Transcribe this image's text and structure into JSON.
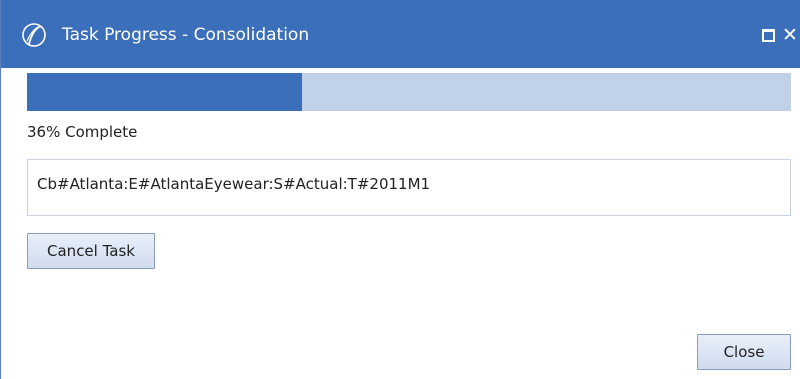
{
  "window": {
    "title": "Task Progress - Consolidation",
    "title_bar_color": "#3c6fb9",
    "maximize_icon": "maximize-icon",
    "close_icon": "close-icon"
  },
  "progress": {
    "fraction": 0.36,
    "label": "36% Complete",
    "fill_color": "#3c6fb9",
    "track_color": "#c2d1ea"
  },
  "status": {
    "current_item": "Cb#Atlanta:E#AtlantaEyewear:S#Actual:T#2011M1"
  },
  "buttons": {
    "cancel_label": "Cancel Task",
    "close_label": "Close"
  }
}
